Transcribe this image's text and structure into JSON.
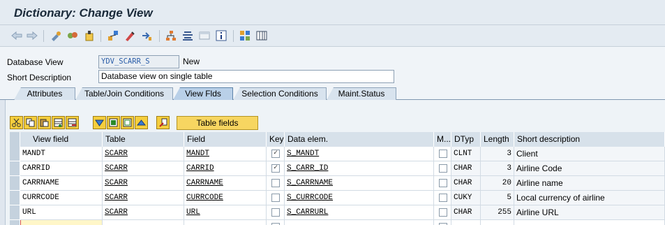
{
  "window": {
    "title": "Dictionary: Change View"
  },
  "toolbar": {
    "icons": [
      "back-arrow-icon",
      "forward-arrow-icon",
      "other-object-icon",
      "display-change-icon",
      "activate-icon",
      "where-used-icon",
      "edit-icon",
      "move-icon",
      "hierarchy-icon",
      "list-icon",
      "layout-icon",
      "info-icon",
      "technical-settings-icon",
      "columns-icon"
    ]
  },
  "header": {
    "view_label": "Database View",
    "view_value": "YDV_SCARR_S",
    "status": "New",
    "short_desc_label": "Short Description",
    "short_desc_value": "Database view on single table"
  },
  "tabs": [
    "Attributes",
    "Table/Join Conditions",
    "View Flds",
    "Selection Conditions",
    "Maint.Status"
  ],
  "active_tab": "View Flds",
  "table_toolbar": {
    "icons": [
      "cut-icon",
      "copy-icon",
      "paste-icon",
      "insert-row-icon",
      "delete-row-icon",
      "select-all-icon",
      "select-block-icon",
      "deselect-icon",
      "collapse-icon",
      "where-used-list-icon"
    ],
    "table_fields_label": "Table fields"
  },
  "grid": {
    "columns": [
      "Key",
      "View field",
      "Table",
      "Field",
      "Key",
      "Data elem.",
      "M...",
      "DTyp",
      "Length",
      "Short description"
    ],
    "rows": [
      {
        "view_field": "MANDT",
        "table": "SCARR",
        "field": "MANDT",
        "key": true,
        "data_elem": "S_MANDT",
        "mod": false,
        "dtyp": "CLNT",
        "length": "3",
        "desc": "Client"
      },
      {
        "view_field": "CARRID",
        "table": "SCARR",
        "field": "CARRID",
        "key": true,
        "data_elem": "S_CARR_ID",
        "mod": false,
        "dtyp": "CHAR",
        "length": "3",
        "desc": "Airline Code"
      },
      {
        "view_field": "CARRNAME",
        "table": "SCARR",
        "field": "CARRNAME",
        "key": false,
        "data_elem": "S_CARRNAME",
        "mod": false,
        "dtyp": "CHAR",
        "length": "20",
        "desc": "Airline name"
      },
      {
        "view_field": "CURRCODE",
        "table": "SCARR",
        "field": "CURRCODE",
        "key": false,
        "data_elem": "S_CURRCODE",
        "mod": false,
        "dtyp": "CUKY",
        "length": "5",
        "desc": "Local currency of airline"
      },
      {
        "view_field": "URL",
        "table": "SCARR",
        "field": "URL",
        "key": false,
        "data_elem": "S_CARRURL",
        "mod": false,
        "dtyp": "CHAR",
        "length": "255",
        "desc": "Airline URL"
      }
    ],
    "check_mark": "✓"
  }
}
